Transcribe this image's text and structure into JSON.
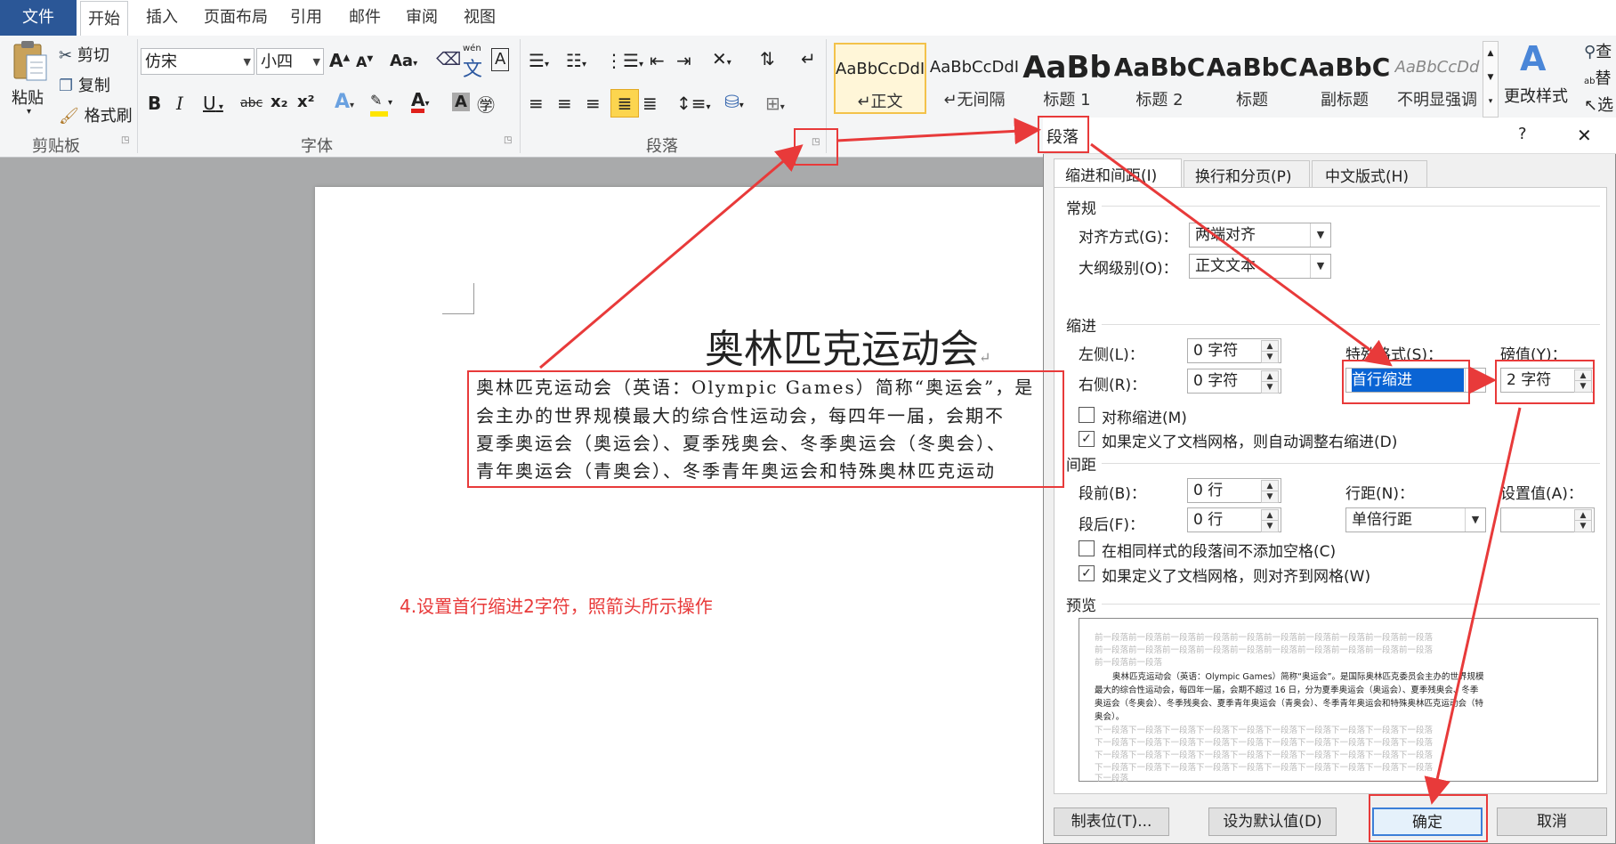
{
  "tabs": [
    "文件",
    "开始",
    "插入",
    "页面布局",
    "引用",
    "邮件",
    "审阅",
    "视图"
  ],
  "clipboard": {
    "paste": "粘贴",
    "cut": "剪切",
    "copy": "复制",
    "format_painter": "格式刷",
    "group": "剪贴板"
  },
  "font": {
    "name": "仿宋",
    "size": "小四",
    "group": "字体",
    "grow": "A",
    "shrink": "A",
    "case": "Aa",
    "bold": "B",
    "italic": "I",
    "underline": "U",
    "strike": "abc",
    "sub": "x₂",
    "sup": "x²",
    "color_a": "A",
    "wen": "wén"
  },
  "paragraph": {
    "group": "段落"
  },
  "styles": [
    {
      "sample": "AaBbCcDdI",
      "name": "↵正文"
    },
    {
      "sample": "AaBbCcDdI",
      "name": "↵无间隔"
    },
    {
      "sample": "AaBb",
      "name": "标题 1"
    },
    {
      "sample": "AaBbC",
      "name": "标题 2"
    },
    {
      "sample": "AaBbC",
      "name": "标题"
    },
    {
      "sample": "AaBbC",
      "name": "副标题"
    },
    {
      "sample": "AaBbCcDd",
      "name": "不明显强调"
    }
  ],
  "change_styles": "更改样式",
  "right_edge": {
    "a": "查",
    "b": "替",
    "c": "选"
  },
  "document": {
    "title": "奥林匹克运动会",
    "lines": [
      "奥林匹克运动会（英语：Olympic Games）简称“奥运会”，是",
      "会主办的世界规模最大的综合性运动会，每四年一届，会期不",
      "夏季奥运会（奥运会）、夏季残奥会、冬季奥运会（冬奥会）、",
      "青年奥运会（青奥会）、冬季青年奥运会和特殊奥林匹克运动"
    ],
    "annotation": "4.设置首行缩进2字符，照箭头所示操作"
  },
  "dialog": {
    "title": "段落",
    "help": "?",
    "close": "✕",
    "tabs": [
      "缩进和间距(I)",
      "换行和分页(P)",
      "中文版式(H)"
    ],
    "general": {
      "heading": "常规",
      "alignment_label": "对齐方式(G)：",
      "alignment": "两端对齐",
      "outline_label": "大纲级别(O)：",
      "outline": "正文文本"
    },
    "indent": {
      "heading": "缩进",
      "left_label": "左侧(L)：",
      "left": "0 字符",
      "right_label": "右侧(R)：",
      "right": "0 字符",
      "special_label": "特殊格式(S)：",
      "special": "首行缩进",
      "by_label": "磅值(Y)：",
      "by": "2 字符",
      "mirror": "对称缩进(M)",
      "auto_adjust": "如果定义了文档网格，则自动调整右缩进(D)"
    },
    "spacing": {
      "heading": "间距",
      "before_label": "段前(B)：",
      "before": "0 行",
      "after_label": "段后(F)：",
      "after": "0 行",
      "line_label": "行距(N)：",
      "line": "单倍行距",
      "at_label": "设置值(A)：",
      "at": "",
      "no_space": "在相同样式的段落间不添加空格(C)",
      "snap_grid": "如果定义了文档网格，则对齐到网格(W)"
    },
    "preview": {
      "heading": "预览",
      "prev_lines": [
        "前一段落前一段落前一段落前一段落前一段落前一段落前一段落前一段落前一段落前一段落",
        "前一段落前一段落前一段落前一段落前一段落前一段落前一段落前一段落前一段落前一段落",
        "前一段落前一段落"
      ],
      "body_lines": [
        "奥林匹克运动会（英语：Olympic Games）简称“奥运会”。是国际奥林匹克委员会主办的世界规模",
        "最大的综合性运动会，每四年一届，会期不超过 16 日，分为夏季奥运会（奥运会）、夏季残奥会、冬季",
        "奥运会（冬奥会）、冬季残奥会、夏季青年奥运会（青奥会）、冬季青年奥运会和特殊奥林匹克运动会（特",
        "奥会）。"
      ],
      "next_lines": [
        "下一段落下一段落下一段落下一段落下一段落下一段落下一段落下一段落下一段落下一段落",
        "下一段落下一段落下一段落下一段落下一段落下一段落下一段落下一段落下一段落下一段落",
        "下一段落下一段落下一段落下一段落下一段落下一段落下一段落下一段落下一段落下一段落",
        "下一段落下一段落下一段落下一段落下一段落下一段落下一段落下一段落下一段落下一段落",
        "下一段落"
      ]
    },
    "buttons": {
      "tabs": "制表位(T)...",
      "default": "设为默认值(D)",
      "ok": "确定",
      "cancel": "取消"
    }
  },
  "colors": {
    "accent": "#2b5797",
    "annotation": "#e83a3a",
    "selected": "#0a64d4"
  }
}
